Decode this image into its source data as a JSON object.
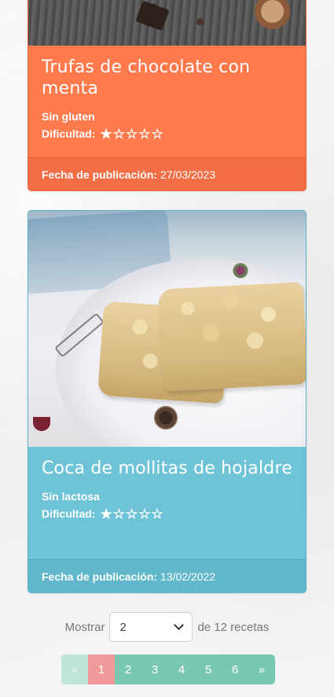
{
  "recipes": [
    {
      "title": "Trufas de chocolate con menta",
      "tag": "Sin gluten",
      "difficulty_label": "Dificultad:",
      "difficulty_rating": 1,
      "difficulty_max": 5,
      "date_label": "Fecha de publicación:",
      "date": "27/03/2023",
      "color": "#ff7a4d"
    },
    {
      "title": "Coca de mollitas de hojaldre",
      "tag": "Sin lactosa",
      "difficulty_label": "Dificultad:",
      "difficulty_rating": 1,
      "difficulty_max": 5,
      "date_label": "Fecha de publicación:",
      "date": "13/02/2022",
      "color": "#6ec4d6"
    }
  ],
  "per_page": {
    "label_before": "Mostrar",
    "selected": "2",
    "label_after": "de 12 recetas"
  },
  "pagination": {
    "prev": "«",
    "pages": [
      "1",
      "2",
      "3",
      "4",
      "5",
      "6"
    ],
    "active_page": "1",
    "next": "»",
    "accent_color": "#79c8b1",
    "active_color": "#f0999a"
  }
}
